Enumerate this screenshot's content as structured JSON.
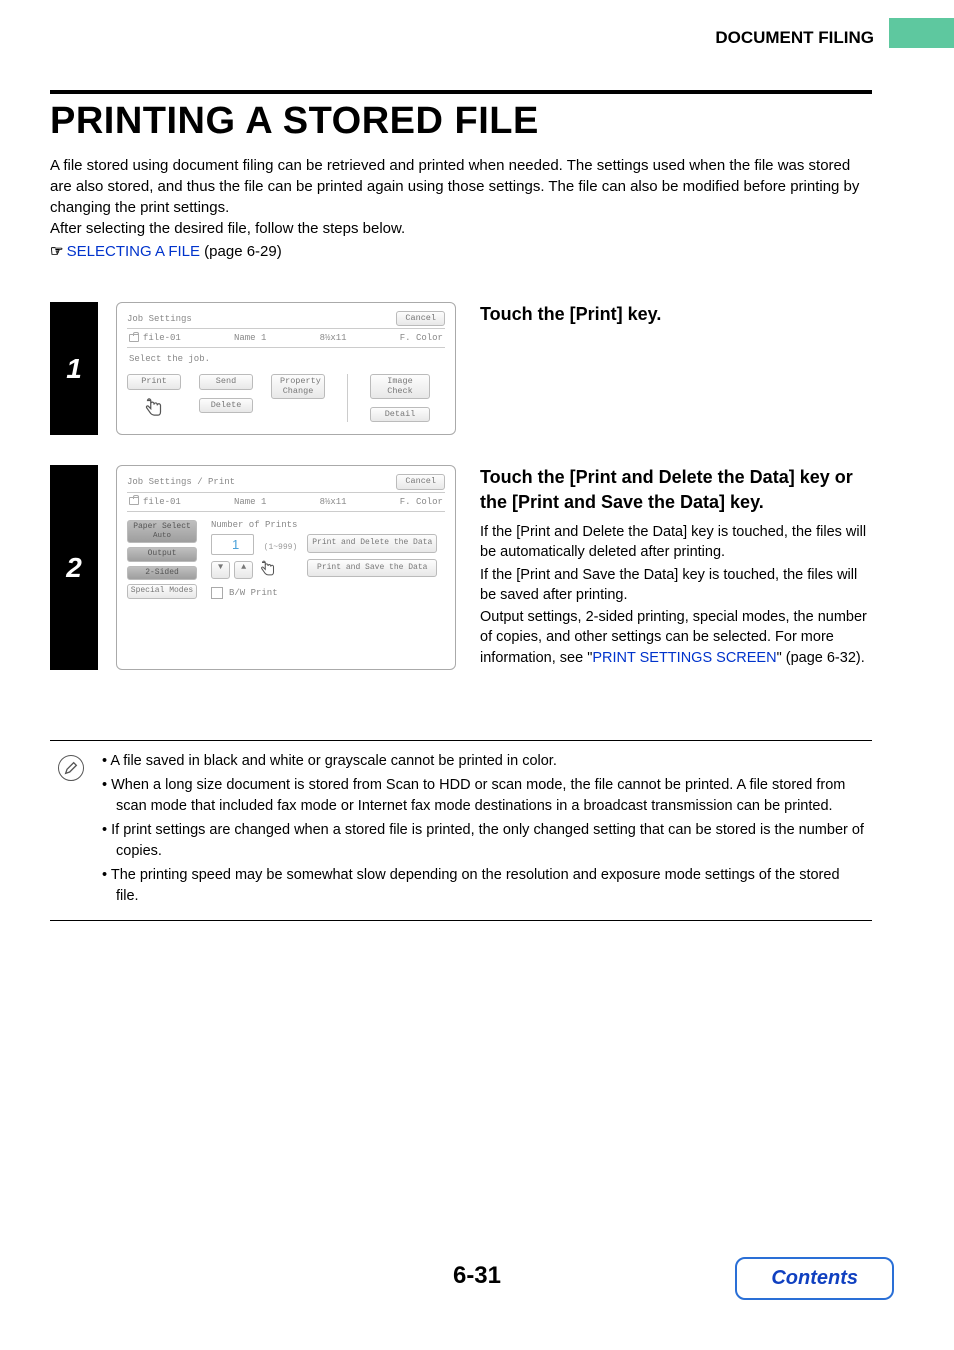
{
  "header": {
    "section": "DOCUMENT FILING"
  },
  "title": "PRINTING A STORED FILE",
  "intro": {
    "p1": "A file stored using document filing can be retrieved and printed when needed. The settings used when the file was stored are also stored, and thus the file can be printed again using those settings. The file can also be modified before printing by changing the print settings.",
    "p2": "After selecting the desired file, follow the steps below.",
    "xref_link": "SELECTING A FILE",
    "xref_page": " (page 6-29)"
  },
  "step1": {
    "num": "1",
    "title": "Touch the [Print] key.",
    "screen": {
      "header": "Job Settings",
      "cancel": "Cancel",
      "file": "file-01",
      "name": "Name 1",
      "size": "8½x11",
      "color": "F. Color",
      "select_label": "Select the job.",
      "btn_print": "Print",
      "btn_send": "Send",
      "btn_property": "Property\nChange",
      "btn_image": "Image Check",
      "btn_delete": "Delete",
      "btn_detail": "Detail"
    }
  },
  "step2": {
    "num": "2",
    "title": "Touch the [Print and Delete the Data] key or the [Print and Save the Data] key.",
    "body": {
      "p1": "If the [Print and Delete the Data] key is touched, the files will be automatically deleted after printing.",
      "p2": "If the [Print and Save the Data] key is touched, the files will be saved after printing.",
      "p3a": "Output settings, 2-sided printing, special modes, the number of copies, and other settings can be selected. For more information, see \"",
      "p3_link": "PRINT SETTINGS SCREEN",
      "p3b": "\" (page 6-32)."
    },
    "screen": {
      "header": "Job Settings / Print",
      "cancel": "Cancel",
      "file": "file-01",
      "name": "Name 1",
      "size": "8½x11",
      "color": "F. Color",
      "left": {
        "paper_select": "Paper Select",
        "auto": "Auto",
        "output": "Output",
        "two_sided": "2-Sided",
        "special": "Special Modes"
      },
      "num_label": "Number of Prints",
      "num_value": "1",
      "num_range": "(1~999)",
      "action_delete": "Print and Delete the Data",
      "action_save": "Print and Save the Data",
      "bw": "B/W Print"
    }
  },
  "notes": {
    "n1": "A file saved in black and white or grayscale cannot be printed in color.",
    "n2": "When a long size document is stored from Scan to HDD or scan mode, the file cannot be printed. A file stored from scan mode that included fax mode or Internet fax mode destinations in a broadcast transmission can be printed.",
    "n3": "If print settings are changed when a stored file is printed, the only changed setting that can be stored is the number of copies.",
    "n4": "The printing speed may be somewhat slow depending on the resolution and exposure mode settings of the stored file."
  },
  "footer": {
    "page": "6-31",
    "contents": "Contents"
  }
}
